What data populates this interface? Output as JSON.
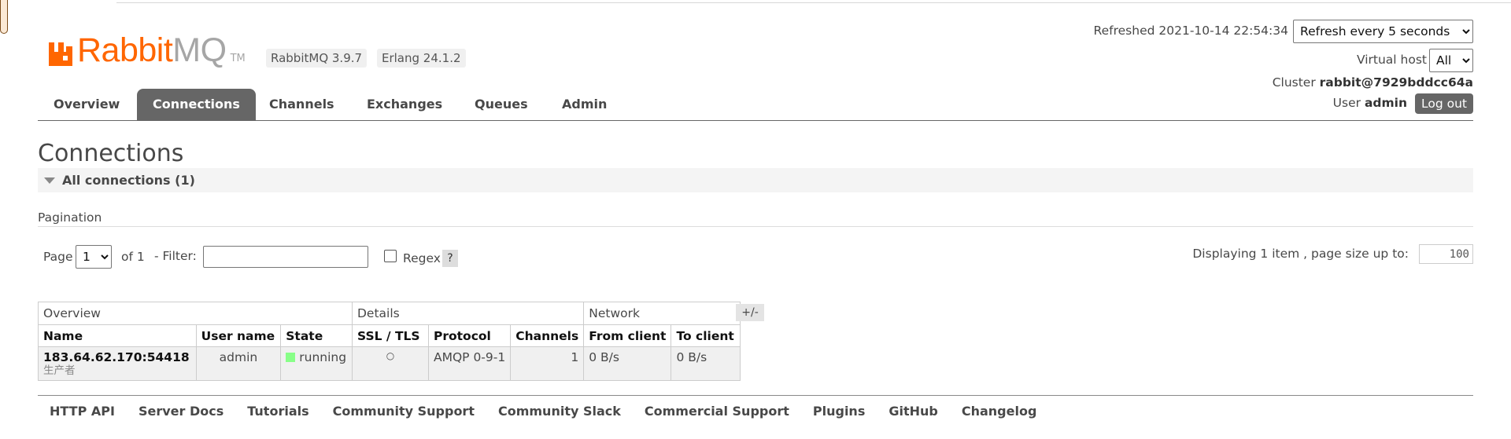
{
  "brand": {
    "name_a": "Rabbit",
    "name_b": "MQ",
    "tm": "TM",
    "rabbitmq_version": "RabbitMQ 3.9.7",
    "erlang_version": "Erlang 24.1.2",
    "accent": "#ff6600"
  },
  "header": {
    "refreshed": "Refreshed 2021-10-14 22:54:34",
    "refresh_option": "Refresh every 5 seconds",
    "vhost_label": "Virtual host",
    "vhost_value": "All",
    "cluster_label": "Cluster",
    "cluster_value": "rabbit@7929bddcc64a",
    "user_label": "User",
    "user_value": "admin",
    "logout": "Log out"
  },
  "tabs": [
    {
      "label": "Overview",
      "active": false
    },
    {
      "label": "Connections",
      "active": true
    },
    {
      "label": "Channels",
      "active": false
    },
    {
      "label": "Exchanges",
      "active": false
    },
    {
      "label": "Queues",
      "active": false
    },
    {
      "label": "Admin",
      "active": false
    }
  ],
  "page": {
    "title": "Connections",
    "section": "All connections (1)",
    "pagination_label": "Pagination",
    "page_label": "Page",
    "page_value": "1",
    "of_label": "of 1",
    "filter_label": "- Filter:",
    "filter_value": "",
    "regex_label": "Regex",
    "help": "?",
    "display_label": "Displaying 1 item , page size up to:",
    "page_size": "100"
  },
  "table": {
    "groups": [
      "Overview",
      "Details",
      "Network"
    ],
    "plus_minus": "+/-",
    "headers": [
      "Name",
      "User name",
      "State",
      "SSL / TLS",
      "Protocol",
      "Channels",
      "From client",
      "To client"
    ],
    "rows": [
      {
        "name": "183.64.62.170:54418",
        "name_sub": "生产者",
        "user": "admin",
        "state": "running",
        "ssl": "○",
        "protocol": "AMQP 0-9-1",
        "channels": "1",
        "from_client": "0 B/s",
        "to_client": "0 B/s"
      }
    ]
  },
  "footer": [
    "HTTP API",
    "Server Docs",
    "Tutorials",
    "Community Support",
    "Community Slack",
    "Commercial Support",
    "Plugins",
    "GitHub",
    "Changelog"
  ]
}
